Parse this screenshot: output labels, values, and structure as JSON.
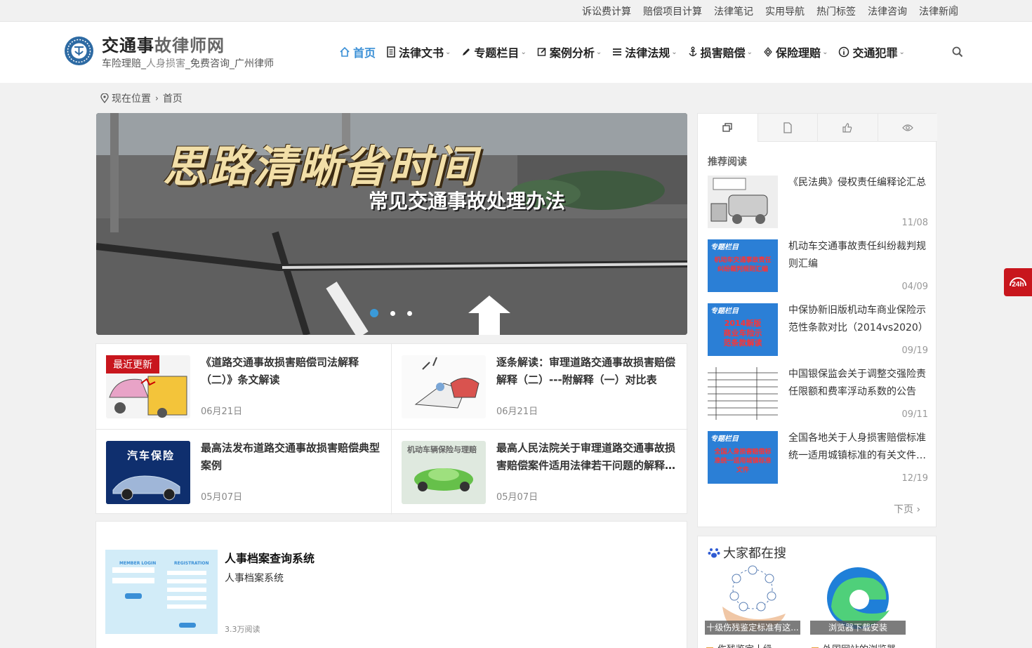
{
  "topbar": {
    "links": [
      "诉讼费计算",
      "赔偿项目计算",
      "法律笔记",
      "实用导航",
      "热门标签",
      "法律咨询",
      "法律新闻"
    ]
  },
  "header": {
    "title_part1": "交通事",
    "title_part2": "故律师网",
    "subtitle_part1": "车险理赔_",
    "subtitle_part2": "人身损害",
    "subtitle_part3": "_免费咨询_广州律师"
  },
  "nav": {
    "items": [
      {
        "label": "首页",
        "icon": "home-icon",
        "active": true
      },
      {
        "label": "法律文书",
        "icon": "document-icon"
      },
      {
        "label": "专题栏目",
        "icon": "pencil-icon"
      },
      {
        "label": "案例分析",
        "icon": "edit-icon"
      },
      {
        "label": "法律法规",
        "icon": "list-icon"
      },
      {
        "label": "损害赔偿",
        "icon": "anchor-icon"
      },
      {
        "label": "保险理赔",
        "icon": "diamond-icon"
      },
      {
        "label": "交通犯罪",
        "icon": "info-icon"
      }
    ],
    "chevron": "⌄"
  },
  "breadcrumb": {
    "current": "现在位置",
    "home": "首页"
  },
  "slider": {
    "headline": "思路清晰省时间",
    "subline": "常见交通事故处理办法",
    "dots": 3,
    "active_dot": 0
  },
  "latest_badge": "最近更新",
  "posts": [
    {
      "title": "《道路交通事故损害赔偿司法解释（二）》条文解读",
      "date": "06月21日"
    },
    {
      "title": "逐条解读：审理道路交通事故损害赔偿解释（二）---附解释（一）对比表",
      "date": "06月21日"
    },
    {
      "title": "最高法发布道路交通事故损害赔偿典型案例",
      "date": "05月07日",
      "thumb_text": "汽车保险"
    },
    {
      "title": "最高人民法院关于审理道路交通事故损害赔偿案件适用法律若干问题的解释（一）",
      "date": "05月07日",
      "thumb_text": "机动车辆保险与理赔"
    }
  ],
  "feature": {
    "title": "人事档案查询系统",
    "desc": "人事档案系统",
    "reads": "3.3万阅读",
    "thumb_left": "MEMBER LOGIN",
    "thumb_right": "REGISTRATION"
  },
  "sidebar": {
    "heading": "推荐阅读",
    "items": [
      {
        "title": "《民法典》侵权责任编释论汇总",
        "date": "11/08"
      },
      {
        "title": "机动车交通事故责任纠纷裁判规则汇编",
        "date": "04/09",
        "thumb_tag": "专题栏目",
        "thumb_text": "机动车交通事故责任纠纷裁判规则汇编"
      },
      {
        "title": "中保协新旧版机动车商业保险示范性条款对比（2014vs2020）",
        "date": "09/19",
        "thumb_tag": "专题栏目",
        "thumb_text": "2014新版商业车险示范条款解读"
      },
      {
        "title": "中国银保监会关于调整交强险责任限额和费率浮动系数的公告",
        "date": "09/11"
      },
      {
        "title": "全国各地关于人身损害赔偿标准统一适用城镇标准的有关文件汇总",
        "date": "12/19",
        "thumb_tag": "专题栏目",
        "thumb_text": "全国人身损害赔偿标准统一适用城镇标准文件"
      }
    ],
    "next_label": "下页"
  },
  "hot_search": {
    "heading": "大家都在搜",
    "cards": [
      {
        "caption": "十级伤残鉴定标准有这..."
      },
      {
        "caption": "浏览器下载安装"
      }
    ],
    "below": [
      "伤残鉴定十级",
      "外国网站的浏览器"
    ]
  },
  "colors": {
    "accent": "#3a8fd6",
    "badge": "#c8161d"
  }
}
